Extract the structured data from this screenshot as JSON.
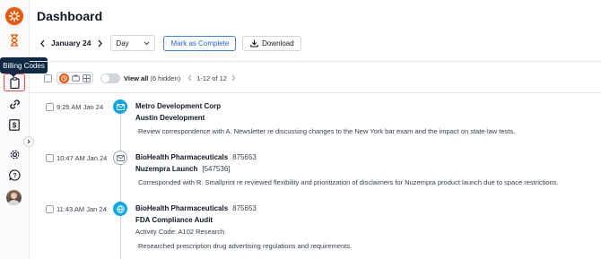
{
  "sidebar": {
    "tooltip": "Billing Codes",
    "icons": [
      "logo-icon",
      "hourglass-icon",
      "clipboard-icon",
      "link-icon",
      "dollar-icon",
      "gear-icon",
      "help-icon",
      "avatar"
    ]
  },
  "header": {
    "title": "Dashboard",
    "date": "January 24",
    "view_select": "Day",
    "mark_complete": "Mark as Complete",
    "download": "Download"
  },
  "toolbar": {
    "view_all": "View all",
    "hidden_count": "(6 hidden)",
    "pagination": "1-12 of 12"
  },
  "colors": {
    "accent_orange": "#ea580c",
    "accent_blue": "#0ea5e9",
    "primary_button": "#2563eb",
    "tooltip_bg": "#0f2a44"
  },
  "entries": [
    {
      "time": "9:25 AM Jan 24",
      "icon": "mail-icon",
      "client": "Metro Development Corp",
      "client_code": "",
      "matter": "Austin Development",
      "matter_code": "",
      "activity": "",
      "description": "Review correspondence with A. Newsletter re discussing changes to the New York bar exam and the impact on state-law tests."
    },
    {
      "time": "10:47 AM Jan 24",
      "icon": "mail-outline-icon",
      "client": "BioHealth Pharmaceuticals",
      "client_code": "875653",
      "matter": "Nuzempra Launch",
      "matter_code": "[547536]",
      "activity": "",
      "description": "Corresponded with R. Smallprint re reviewed flexibility and prioritization of disclaimers for Nuzempra product launch due to space restrictions."
    },
    {
      "time": "11:43 AM Jan 24",
      "icon": "globe-icon",
      "client": "BioHealth Pharmaceuticals",
      "client_code": "875653",
      "matter": "FDA Compliance Audit",
      "matter_code": "",
      "activity": "Activity Code: A102 Research",
      "description": "Researched prescription drug advertising regulations and requirements."
    }
  ]
}
